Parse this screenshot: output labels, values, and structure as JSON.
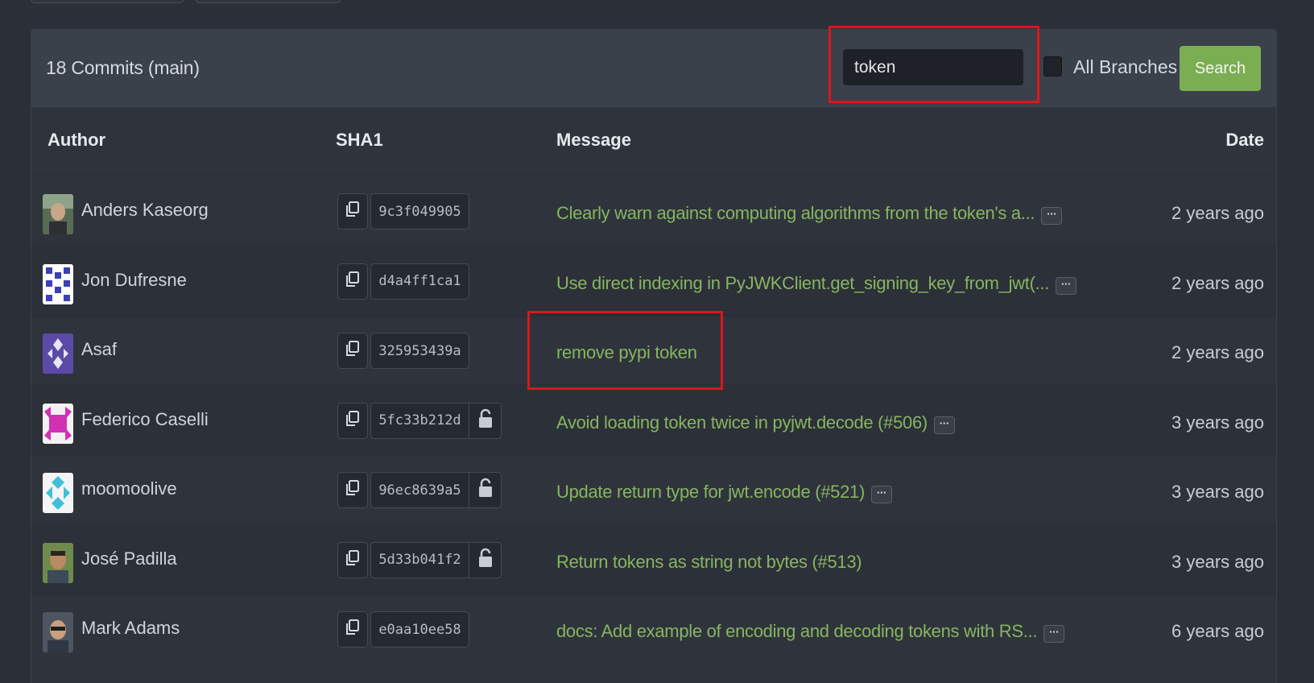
{
  "header": {
    "commit_count": "18 Commits (main)",
    "search_value": "token",
    "all_branches_label": "All Branches",
    "search_button": "Search"
  },
  "columns": {
    "author": "Author",
    "sha": "SHA1",
    "message": "Message",
    "date": "Date"
  },
  "commits": [
    {
      "author": "Anders Kaseorg",
      "sha": "9c3f049905",
      "message": "Clearly warn against computing algorithms from the token's a...",
      "has_more": true,
      "signed_lock": false,
      "date": "2 years ago"
    },
    {
      "author": "Jon Dufresne",
      "sha": "d4a4ff1ca1",
      "message": "Use direct indexing in PyJWKClient.get_signing_key_from_jwt(...",
      "has_more": true,
      "signed_lock": false,
      "date": "2 years ago"
    },
    {
      "author": "Asaf",
      "sha": "325953439a",
      "message": "remove pypi token",
      "has_more": false,
      "signed_lock": false,
      "date": "2 years ago"
    },
    {
      "author": "Federico Caselli",
      "sha": "5fc33b212d",
      "message": "Avoid loading token twice in pyjwt.decode (#506)",
      "has_more": true,
      "signed_lock": true,
      "date": "3 years ago"
    },
    {
      "author": "moomoolive",
      "sha": "96ec8639a5",
      "message": "Update return type for jwt.encode (#521)",
      "has_more": true,
      "signed_lock": true,
      "date": "3 years ago"
    },
    {
      "author": "José Padilla",
      "sha": "5d33b041f2",
      "message": "Return tokens as string not bytes (#513)",
      "has_more": false,
      "signed_lock": true,
      "date": "3 years ago"
    },
    {
      "author": "Mark Adams",
      "sha": "e0aa10ee58",
      "message": "docs: Add example of encoding and decoding tokens with RS...",
      "has_more": true,
      "signed_lock": false,
      "date": "6 years ago"
    }
  ],
  "icons": {
    "copy": "copy-icon",
    "lock": "unlock-icon",
    "more": "ellipsis-icon"
  },
  "colors": {
    "accent_green": "#7bae52",
    "message_green": "#87b560",
    "highlight_red": "#e0141b"
  }
}
